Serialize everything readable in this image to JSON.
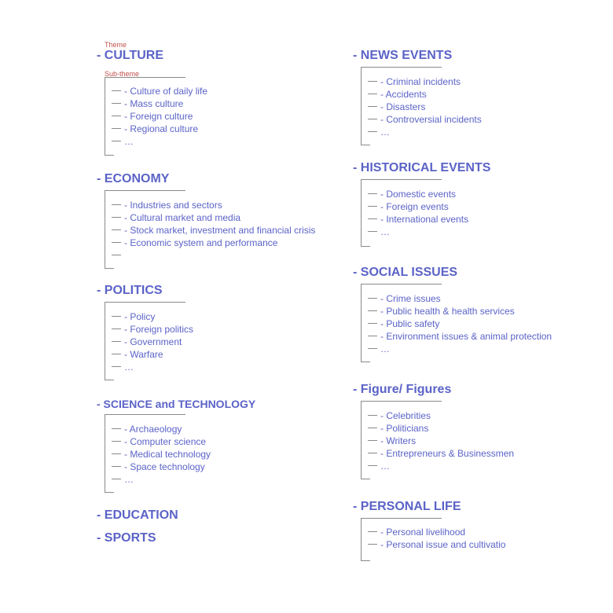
{
  "annotations": {
    "theme": "Theme",
    "sub_theme": "Sub-theme"
  },
  "themes": [
    {
      "title": "- CULTURE",
      "items": [
        "- Culture of daily life",
        "- Mass culture",
        "- Foreign culture",
        "- Regional culture",
        "…"
      ]
    },
    {
      "title": "- ECONOMY",
      "items": [
        "- Industries and sectors",
        "- Cultural market and media",
        "- Stock market, investment and financial crisis",
        "- Economic system and performance",
        ""
      ]
    },
    {
      "title": "- POLITICS",
      "items": [
        "- Policy",
        "- Foreign politics",
        "- Government",
        "- Warfare",
        "…"
      ]
    },
    {
      "title": "- SCIENCE and TECHNOLOGY",
      "items": [
        "- Archaeology",
        "- Computer science",
        "- Medical technology",
        "- Space technology",
        "…"
      ]
    },
    {
      "title": "- EDUCATION",
      "items": []
    },
    {
      "title": "- SPORTS",
      "items": []
    },
    {
      "title": "- NEWS EVENTS",
      "items": [
        "- Criminal incidents",
        "- Accidents",
        "- Disasters",
        "- Controversial incidents",
        "…"
      ]
    },
    {
      "title": "- HISTORICAL EVENTS",
      "items": [
        "- Domestic events",
        "- Foreign events",
        "- International events",
        "…"
      ]
    },
    {
      "title": "- SOCIAL ISSUES",
      "items": [
        "- Crime issues",
        "- Public health & health services",
        "- Public safety",
        "- Environment issues & animal protection",
        "…"
      ]
    },
    {
      "title": "- Figure/ Figures",
      "items": [
        "- Celebrities",
        "- Politicians",
        "- Writers",
        "- Entrepreneurs & Businessmen",
        "…"
      ]
    },
    {
      "title": "- PERSONAL LIFE",
      "items": [
        "- Personal livelihood",
        "- Personal issue and cultivatio"
      ]
    }
  ]
}
